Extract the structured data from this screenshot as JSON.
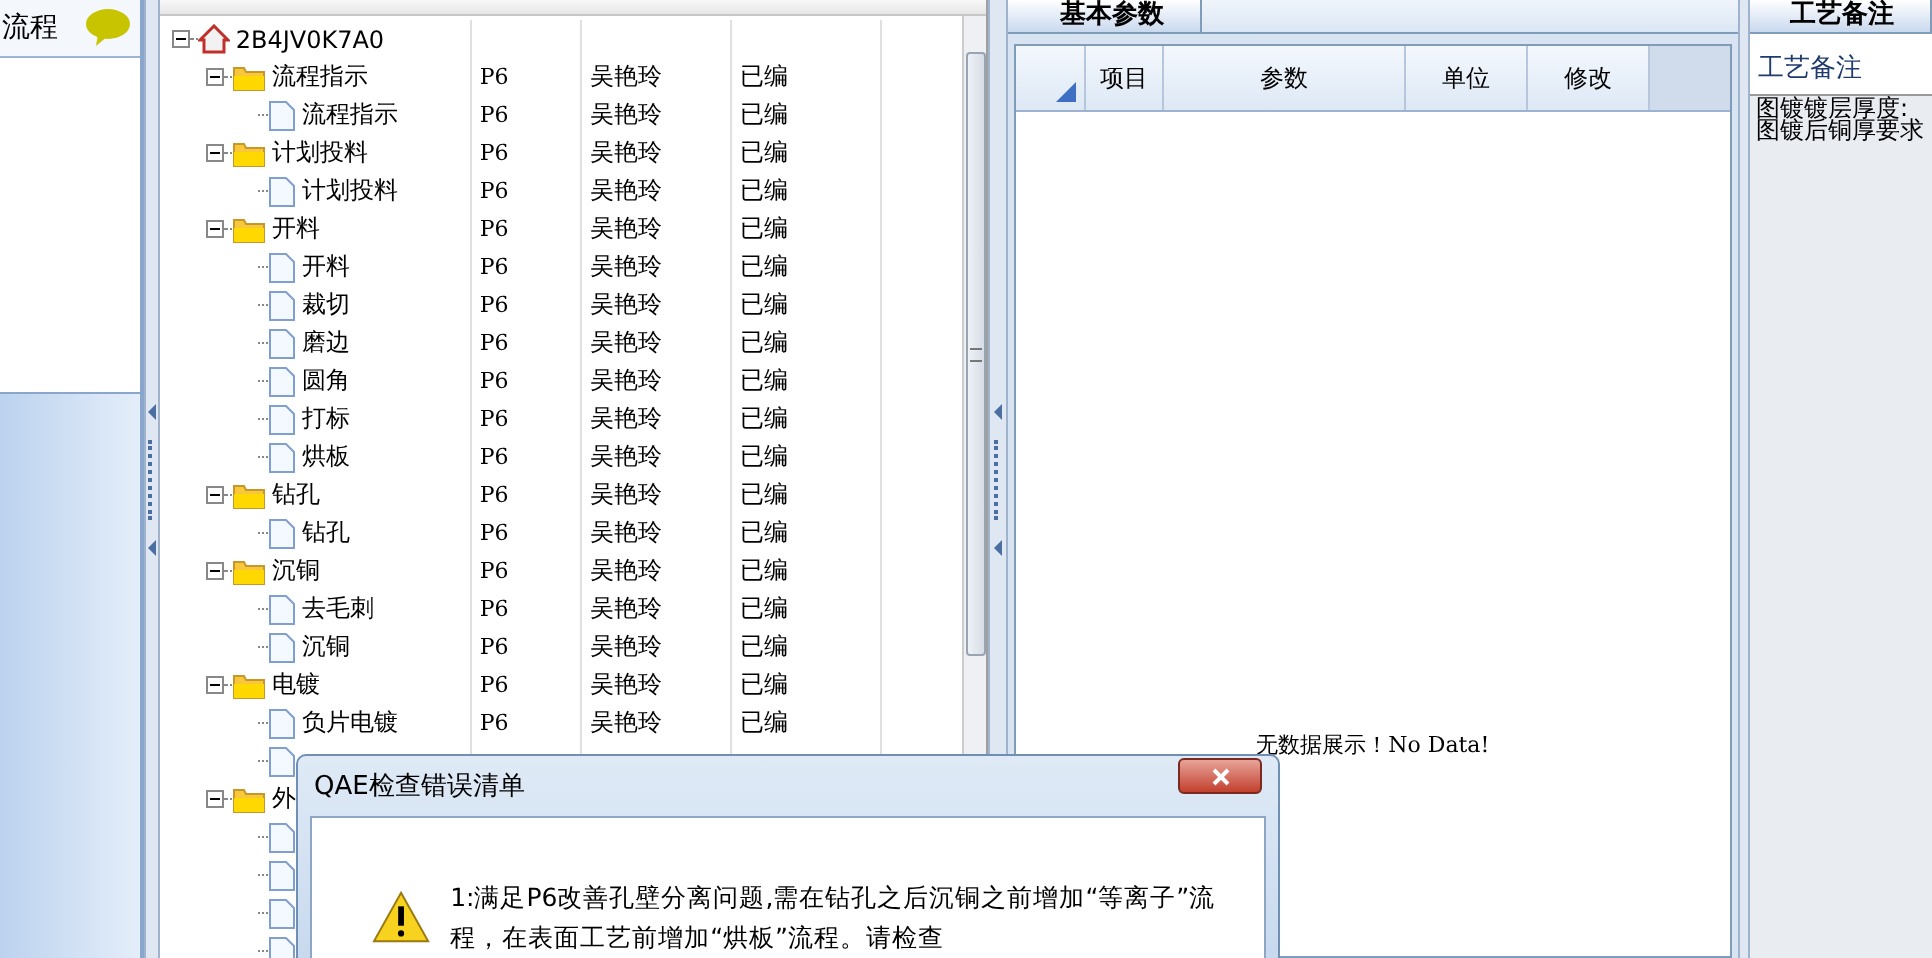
{
  "sidebar": {
    "tab": "流程"
  },
  "tree": {
    "nodes": [
      {
        "kind": "root",
        "label": "2B4JV0K7A0",
        "expanded": true,
        "children": [
          {
            "kind": "folder",
            "label": "流程指示",
            "expanded": true,
            "cells": [
              "P6",
              "吴艳玲",
              "已编"
            ],
            "children": [
              {
                "kind": "doc",
                "label": "流程指示",
                "cells": [
                  "P6",
                  "吴艳玲",
                  "已编"
                ]
              }
            ]
          },
          {
            "kind": "folder",
            "label": "计划投料",
            "expanded": true,
            "cells": [
              "P6",
              "吴艳玲",
              "已编"
            ],
            "children": [
              {
                "kind": "doc",
                "label": "计划投料",
                "cells": [
                  "P6",
                  "吴艳玲",
                  "已编"
                ]
              }
            ]
          },
          {
            "kind": "folder",
            "label": "开料",
            "expanded": true,
            "cells": [
              "P6",
              "吴艳玲",
              "已编"
            ],
            "children": [
              {
                "kind": "doc",
                "label": "开料",
                "cells": [
                  "P6",
                  "吴艳玲",
                  "已编"
                ]
              },
              {
                "kind": "doc",
                "label": "裁切",
                "cells": [
                  "P6",
                  "吴艳玲",
                  "已编"
                ]
              },
              {
                "kind": "doc",
                "label": "磨边",
                "cells": [
                  "P6",
                  "吴艳玲",
                  "已编"
                ]
              },
              {
                "kind": "doc",
                "label": "圆角",
                "cells": [
                  "P6",
                  "吴艳玲",
                  "已编"
                ]
              },
              {
                "kind": "doc",
                "label": "打标",
                "cells": [
                  "P6",
                  "吴艳玲",
                  "已编"
                ]
              },
              {
                "kind": "doc",
                "label": "烘板",
                "cells": [
                  "P6",
                  "吴艳玲",
                  "已编"
                ]
              }
            ]
          },
          {
            "kind": "folder",
            "label": "钻孔",
            "expanded": true,
            "cells": [
              "P6",
              "吴艳玲",
              "已编"
            ],
            "children": [
              {
                "kind": "doc",
                "label": "钻孔",
                "cells": [
                  "P6",
                  "吴艳玲",
                  "已编"
                ]
              }
            ]
          },
          {
            "kind": "folder",
            "label": "沉铜",
            "expanded": true,
            "cells": [
              "P6",
              "吴艳玲",
              "已编"
            ],
            "children": [
              {
                "kind": "doc",
                "label": "去毛刺",
                "cells": [
                  "P6",
                  "吴艳玲",
                  "已编"
                ]
              },
              {
                "kind": "doc",
                "label": "沉铜",
                "cells": [
                  "P6",
                  "吴艳玲",
                  "已编"
                ]
              }
            ]
          },
          {
            "kind": "folder",
            "label": "电镀",
            "expanded": true,
            "cells": [
              "P6",
              "吴艳玲",
              "已编"
            ],
            "children": [
              {
                "kind": "doc",
                "label": "负片电镀",
                "cells": [
                  "P6",
                  "吴艳玲",
                  "已编"
                ]
              },
              {
                "kind": "doc"
              }
            ]
          },
          {
            "kind": "folder",
            "label": "外",
            "expanded": true,
            "children": [
              {
                "kind": "doc"
              },
              {
                "kind": "doc"
              },
              {
                "kind": "doc"
              },
              {
                "kind": "doc"
              }
            ]
          }
        ]
      }
    ]
  },
  "params": {
    "tab": "基本参数",
    "columns": [
      "项目",
      "参数",
      "单位",
      "修改"
    ],
    "empty_text": "无数据展示！No Data!"
  },
  "notes": {
    "tab": "工艺备注",
    "label": "工艺备注",
    "lines": [
      "图镀镀层厚度:",
      "图镀后铜厚要求"
    ]
  },
  "dialog": {
    "title": "QAE检查错误清单",
    "message": [
      "1:满足P6改善孔壁分离问题,需在钻孔之后沉铜之前增加“等离子”流",
      "程，在表面工艺前增加“烘板”流程。请检查"
    ]
  }
}
